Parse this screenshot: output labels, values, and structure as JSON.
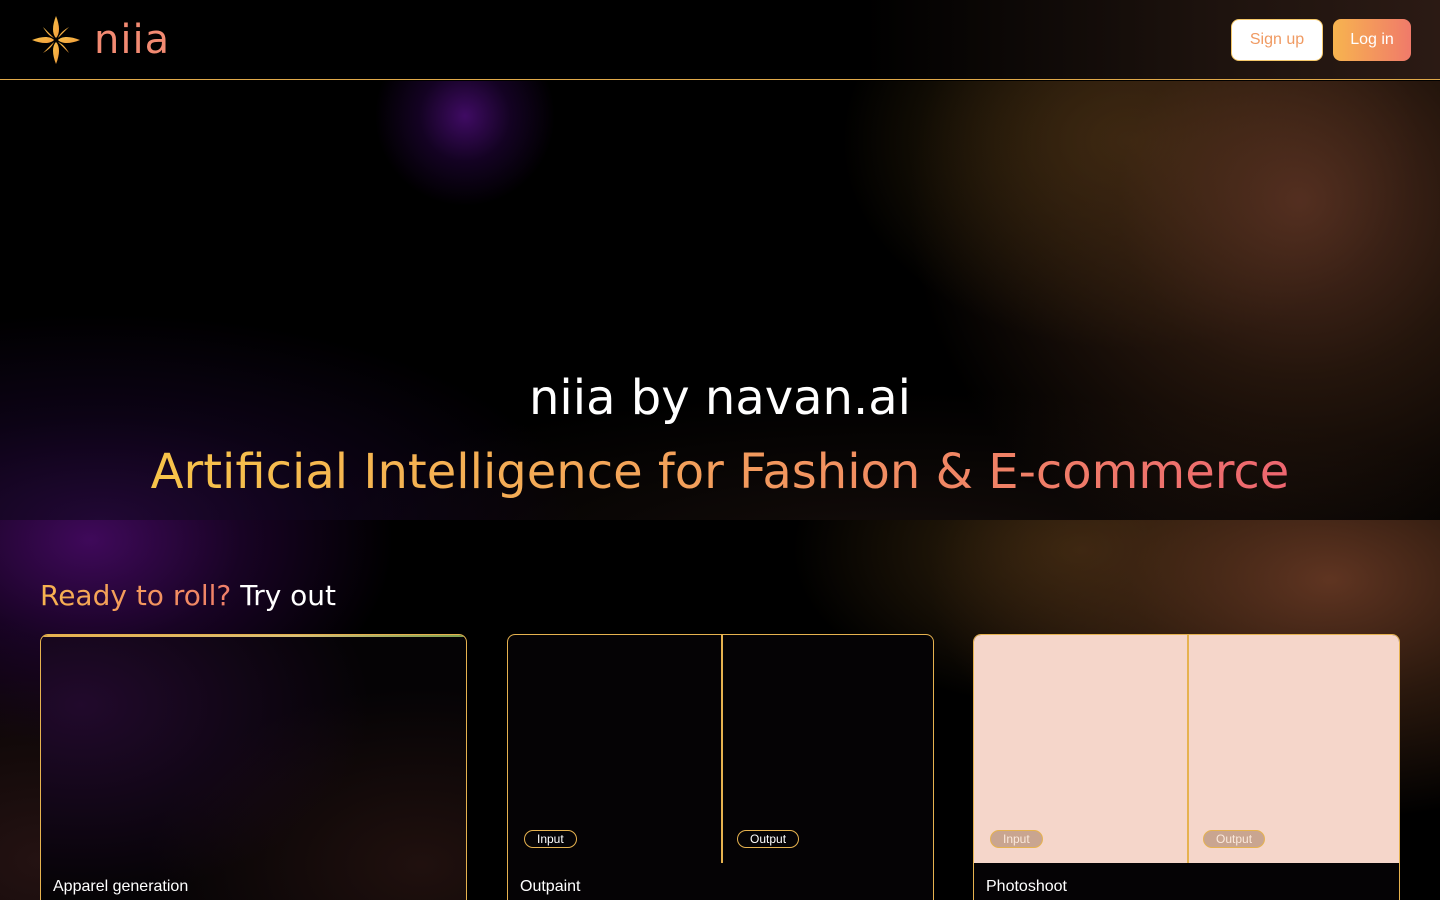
{
  "header": {
    "logo_text": "niia",
    "signup_label": "Sign up",
    "login_label": "Log in"
  },
  "hero": {
    "title": "niia by navan.ai",
    "subtitle": "Artificial Intelligence for Fashion & E-commerce"
  },
  "tryout": {
    "title_accent": "Ready to roll?",
    "title_plain": "Try out",
    "cards": [
      {
        "label": "Apparel generation"
      },
      {
        "label": "Outpaint",
        "input_tag": "Input",
        "output_tag": "Output"
      },
      {
        "label": "Photoshoot",
        "input_tag": "Input",
        "output_tag": "Output"
      }
    ]
  },
  "colors": {
    "accent_gold": "#e6b24f",
    "accent_coral": "#f07a6a",
    "photoshoot_bg": "#f5d6ca"
  },
  "icons": {
    "logo": "niia-flower-logo-icon"
  }
}
